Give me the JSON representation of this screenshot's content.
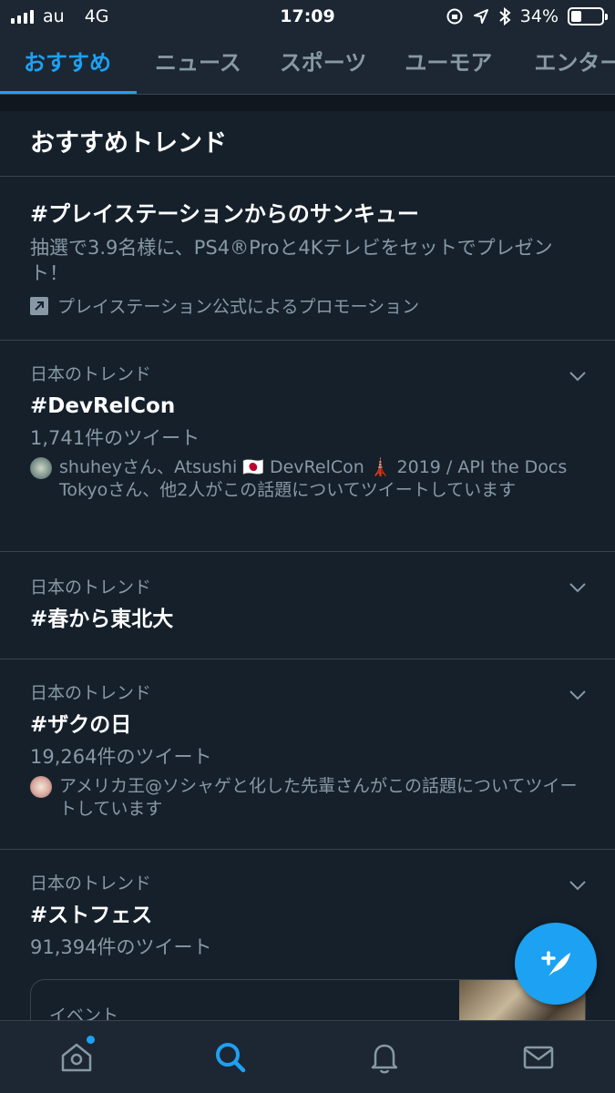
{
  "status_bar": {
    "carrier": "au",
    "network": "4G",
    "time": "17:09",
    "battery_percent": "34%",
    "battery_level": 0.34
  },
  "tabs": [
    {
      "label": "おすすめ",
      "active": true
    },
    {
      "label": "ニュース",
      "active": false
    },
    {
      "label": "スポーツ",
      "active": false
    },
    {
      "label": "ユーモア",
      "active": false
    },
    {
      "label": "エンターテ",
      "active": false
    }
  ],
  "section": {
    "title": "おすすめトレンド"
  },
  "promo": {
    "title": "#プレイステーションからのサンキュー",
    "description": "抽選で3.9名様に、PS4®Proと4Kテレビをセットでプレゼント！",
    "promoted_by": "プレイステーション公式によるプロモーション"
  },
  "trends": [
    {
      "context": "日本のトレンド",
      "name": "#DevRelCon",
      "count": "1,741件のツイート",
      "people": "shuheyさん、Atsushi 🇯🇵 DevRelCon 🗼 2019 / API the Docs Tokyoさん、他2人がこの話題についてツイートしています"
    },
    {
      "context": "日本のトレンド",
      "name": "#春から東北大"
    },
    {
      "context": "日本のトレンド",
      "name": "#ザクの日",
      "count": "19,264件のツイート",
      "people": "アメリカ王@ソシャゲと化した先輩さんがこの話題についてツイートしています"
    },
    {
      "context": "日本のトレンド",
      "name": "#ストフェス",
      "count": "91,394件のツイート"
    }
  ],
  "event_card": {
    "label": "イベント"
  },
  "icons": {
    "home": "home-icon",
    "search": "search-icon",
    "notifications": "bell-icon",
    "messages": "mail-icon",
    "compose": "compose-tweet-icon"
  },
  "colors": {
    "accent": "#1da1f2",
    "background": "#15202b",
    "secondary_text": "#8899a6"
  }
}
